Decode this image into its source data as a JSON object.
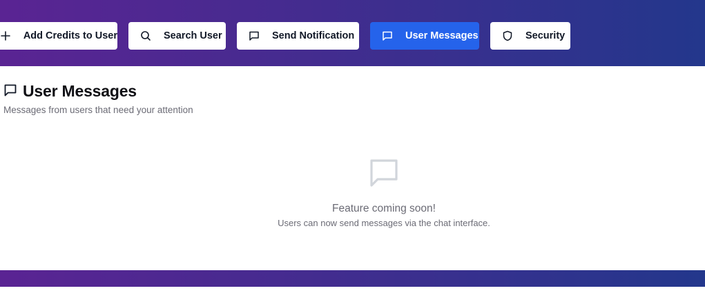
{
  "colors": {
    "header_gradient_start": "#5a2493",
    "header_gradient_end": "#23378c",
    "active_tab": "#2563eb",
    "muted_text": "#6b6b75"
  },
  "tabs": [
    {
      "label": "Add Credits to User",
      "icon": "plus-icon",
      "active": false
    },
    {
      "label": "Search User",
      "icon": "search-icon",
      "active": false
    },
    {
      "label": "Send Notification",
      "icon": "message-square-icon",
      "active": false
    },
    {
      "label": "User Messages",
      "icon": "message-square-icon",
      "active": true
    },
    {
      "label": "Security",
      "icon": "shield-icon",
      "active": false
    }
  ],
  "section": {
    "icon": "message-square-icon",
    "title": "User Messages",
    "subtitle": "Messages from users that need your attention"
  },
  "empty_state": {
    "icon": "message-square-icon",
    "title": "Feature coming soon!",
    "text": "Users can now send messages via the chat interface."
  }
}
